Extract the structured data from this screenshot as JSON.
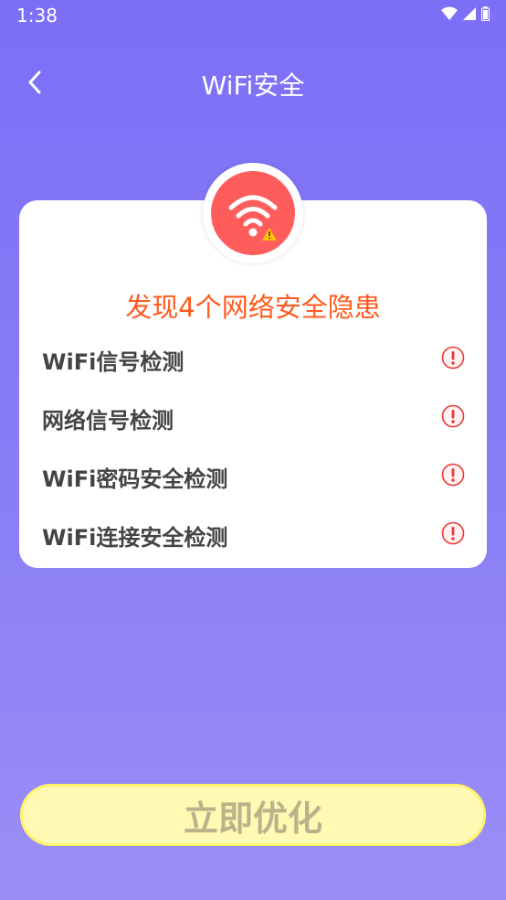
{
  "status_bar": {
    "time": "1:38"
  },
  "nav": {
    "title": "WiFi安全"
  },
  "result": {
    "headline": "发现4个网络安全隐患"
  },
  "checks": [
    {
      "label": "WiFi信号检测"
    },
    {
      "label": "网络信号检测"
    },
    {
      "label": "WiFi密码安全检测"
    },
    {
      "label": "WiFi连接安全检测"
    }
  ],
  "actions": {
    "optimize_label": "立即优化"
  },
  "colors": {
    "background": "#7c6ff7",
    "headline": "#ff5a1f",
    "wifi_badge": "#ff5c5c",
    "warning": "#e53935",
    "button": "#fff9b3"
  },
  "icons": [
    "wifi-icon",
    "signal-icon",
    "battery-icon",
    "back-arrow-icon",
    "wifi-warning-icon",
    "alert-icon"
  ]
}
